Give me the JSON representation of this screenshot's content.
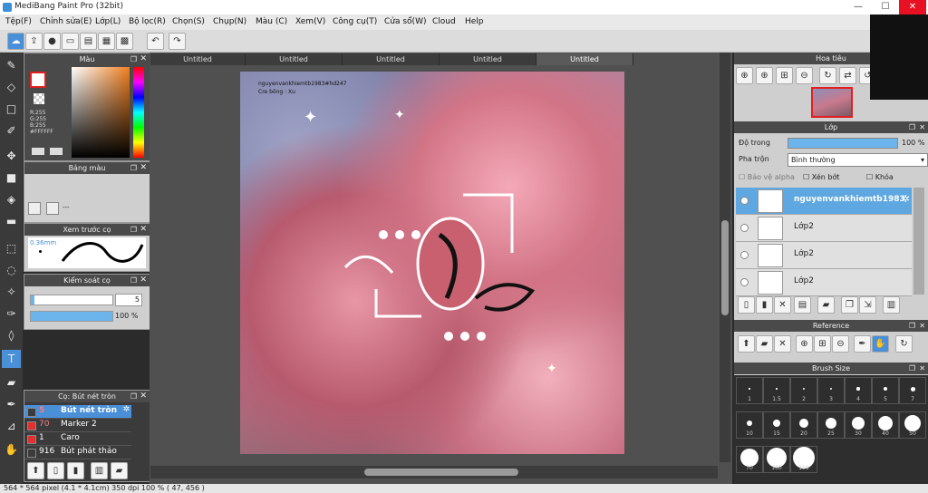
{
  "window": {
    "title": "MediBang Paint Pro (32bit)",
    "minimize": "—",
    "maximize": "☐",
    "close": "✕"
  },
  "menu": [
    "Tệp(F)",
    "Chỉnh sửa(E)",
    "Lớp(L)",
    "Bộ lọc(R)",
    "Chọn(S)",
    "Chụp(N)",
    "Màu (C)",
    "Xem(V)",
    "Công cụ(T)",
    "Cửa sổ(W)",
    "Cloud",
    "Help"
  ],
  "doc_tabs": [
    "Untitled",
    "Untitled",
    "Untitled",
    "Untitled",
    "Untitled"
  ],
  "color_panel": {
    "title": "Màu",
    "r": "R:255",
    "g": "G:255",
    "b": "B:255",
    "hex": "#FFFFFF"
  },
  "palette_panel": {
    "title": "Bảng màu",
    "dash": "---"
  },
  "brush_preview_panel": {
    "title": "Xem trước cọ",
    "size": "0.36mm"
  },
  "brush_control_panel": {
    "title": "Kiểm soát cọ",
    "size_value": "5",
    "opacity_value": "100 %"
  },
  "brush_list_panel": {
    "title": "Cọ: Bút nét tròn",
    "items": [
      {
        "num": "5",
        "name": "Bút nét tròn",
        "color": "#3b3b3b"
      },
      {
        "num": "70",
        "name": "Marker 2",
        "color": "#e03030"
      },
      {
        "num": "1",
        "name": "Caro",
        "color": "#e03030"
      },
      {
        "num": "916",
        "name": "Bút phát thảo",
        "color": "#3b3b3b"
      }
    ]
  },
  "canvas_text": {
    "line1": "nguyenvankhiemtb1983#hd247",
    "line2": "Cre bông : Xu"
  },
  "navigator_panel": {
    "title": "Hoa tiêu"
  },
  "layer_panel": {
    "title": "Lớp",
    "opacity_label": "Độ trong",
    "opacity_value": "100 %",
    "blend_label": "Pha trộn",
    "blend_value": "Bình thường",
    "protect_alpha": "Bảo vệ alpha",
    "clip": "Xén bớt",
    "lock": "Khóa",
    "layers": [
      {
        "name": "nguyenvankhiemtb1983",
        "selected": true
      },
      {
        "name": "Lớp2",
        "selected": false
      },
      {
        "name": "Lớp2",
        "selected": false
      },
      {
        "name": "Lớp2",
        "selected": false
      }
    ]
  },
  "reference_panel": {
    "title": "Reference"
  },
  "brush_size_panel": {
    "title": "Brush Size",
    "sizes": [
      "1",
      "1.5",
      "2",
      "3",
      "4",
      "5",
      "7",
      "10",
      "15",
      "20",
      "25",
      "30",
      "40",
      "50",
      "70",
      "100",
      "150"
    ]
  },
  "status": {
    "text": "564 * 564 pixel   (4.1 * 4.1cm)   350 dpi   100 %   ( 47, 456 )"
  }
}
